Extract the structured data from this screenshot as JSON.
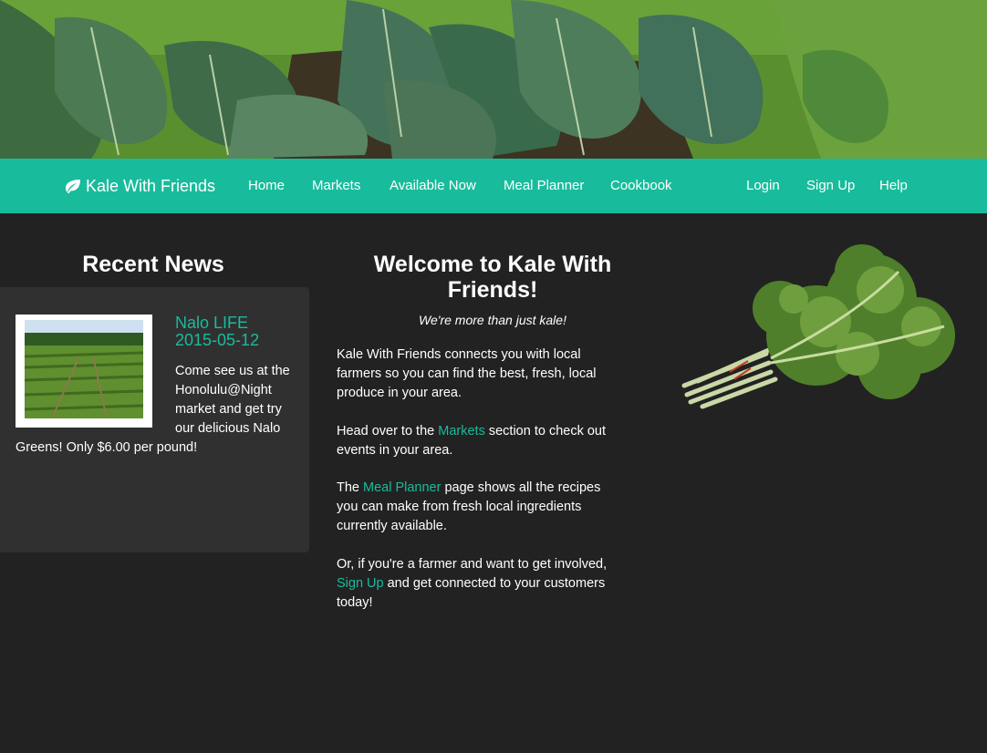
{
  "brand": {
    "name": "Kale With Friends",
    "icon": "leaf-icon"
  },
  "nav": {
    "left": [
      "Home",
      "Markets",
      "Available Now",
      "Meal Planner",
      "Cookbook"
    ],
    "right": [
      "Login",
      "Sign Up",
      "Help"
    ]
  },
  "news": {
    "title": "Recent News",
    "items": [
      {
        "headline": "Nalo LIFE",
        "date": "2015-05-12",
        "body": "Come see us at the Honolulu@Night market and get try our delicious Nalo Greens! Only $6.00 per pound!"
      }
    ]
  },
  "welcome": {
    "title": "Welcome to Kale With Friends!",
    "tagline": "We're more than just kale!",
    "p1": "Kale With Friends connects you with local farmers so you can find the best, fresh, local produce in your area.",
    "p2_pre": "Head over to the ",
    "p2_link": "Markets",
    "p2_post": " section to check out events in your area.",
    "p3_pre": "The ",
    "p3_link": "Meal Planner",
    "p3_post": " page shows all the recipes you can make from fresh local ingredients currently available.",
    "p4_pre": "Or, if you're a farmer and want to get involved, ",
    "p4_link": "Sign Up",
    "p4_post": " and get connected to your customers today!"
  },
  "colors": {
    "accent": "#18bc9c",
    "background": "#222222",
    "panel": "#303030"
  }
}
